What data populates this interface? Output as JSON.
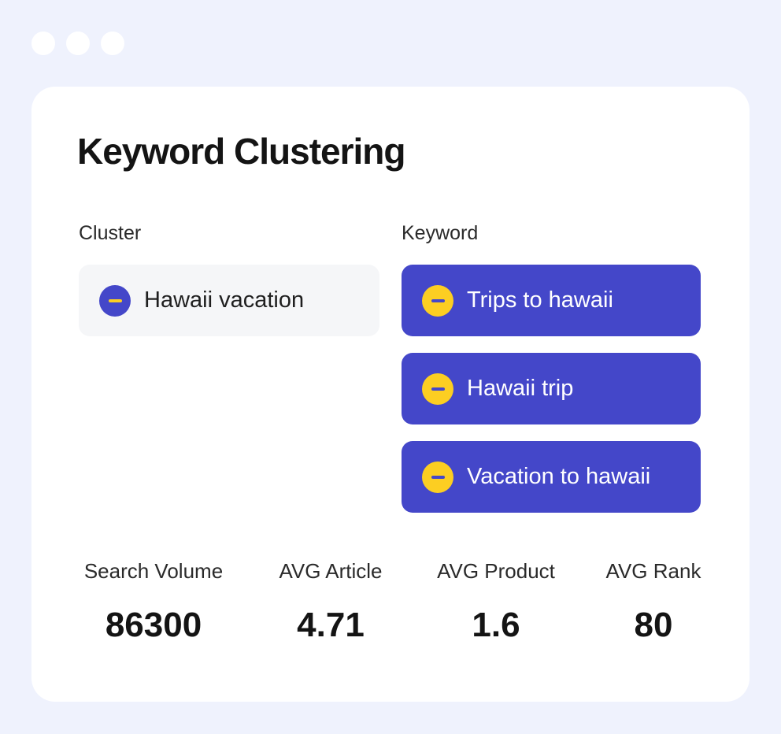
{
  "window": {
    "controls": [
      "window-dot",
      "window-dot",
      "window-dot"
    ]
  },
  "card": {
    "title": "Keyword Clustering",
    "cluster_label": "Cluster",
    "keyword_label": "Keyword",
    "cluster": {
      "name": "Hawaii vacation",
      "icon": "minus-circle-icon"
    },
    "keywords": [
      {
        "name": "Trips to hawaii",
        "icon": "minus-circle-icon"
      },
      {
        "name": "Hawaii trip",
        "icon": "minus-circle-icon"
      },
      {
        "name": "Vacation to hawaii",
        "icon": "minus-circle-icon"
      }
    ],
    "stats": [
      {
        "label": "Search Volume",
        "value": "86300"
      },
      {
        "label": "AVG Article",
        "value": "4.71"
      },
      {
        "label": "AVG Product",
        "value": "1.6"
      },
      {
        "label": "AVG Rank",
        "value": "80"
      }
    ]
  },
  "colors": {
    "background": "#eff2fd",
    "accent_blue": "#4447c9",
    "accent_yellow": "#fcce22",
    "cluster_chip_bg": "#f5f6f8"
  }
}
